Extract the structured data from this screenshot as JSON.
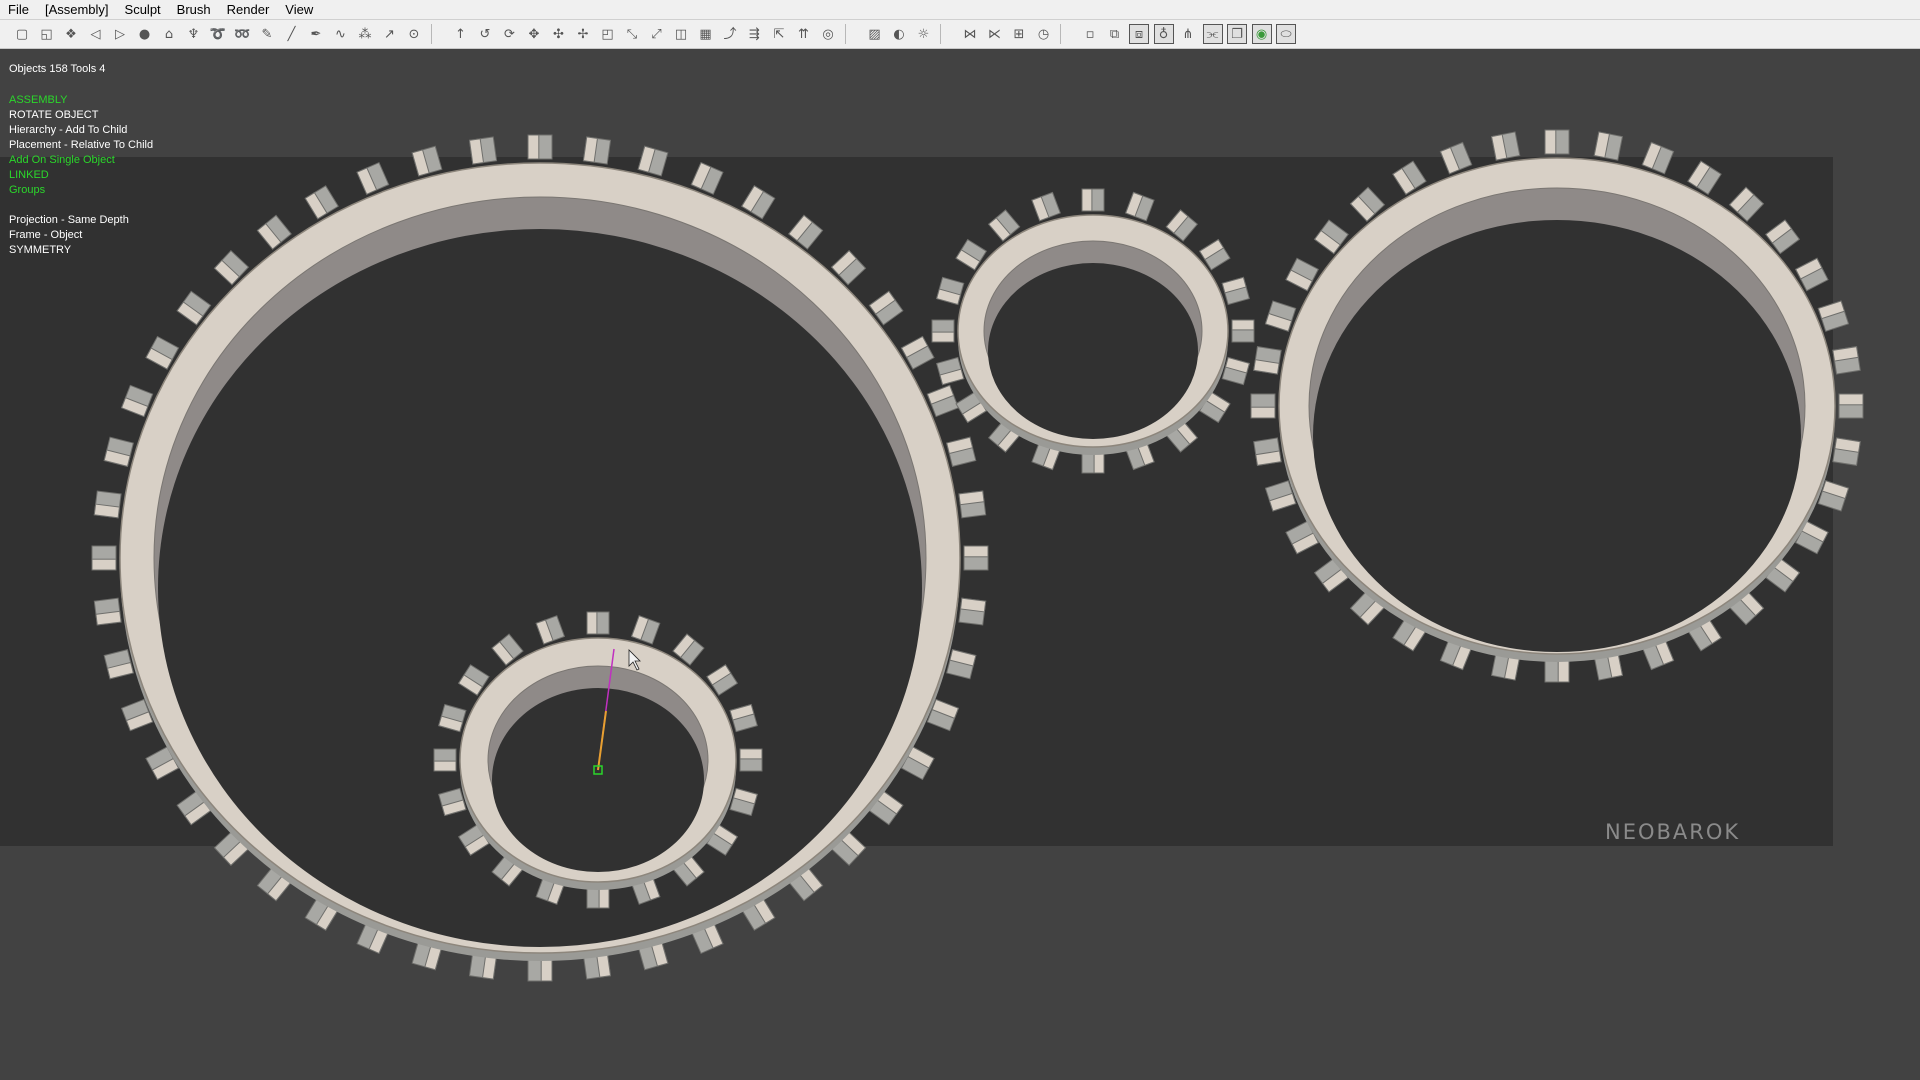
{
  "menu": {
    "items": [
      {
        "label": "File"
      },
      {
        "label": "[Assembly]"
      },
      {
        "label": "Sculpt"
      },
      {
        "label": "Brush"
      },
      {
        "label": "Render"
      },
      {
        "label": "View"
      }
    ]
  },
  "toolbar": {
    "groups": [
      [
        "new-icon",
        "open-icon",
        "snowflake-icon",
        "undo-icon",
        "redo-icon",
        "sphere-icon",
        "home-icon",
        "tree-icon",
        "lasso-icon",
        "lasso-plus-icon",
        "brush-icon",
        "line-icon",
        "pen-icon",
        "curve-icon",
        "spray-icon",
        "grab-icon",
        "target-icon"
      ],
      [
        "pin-icon",
        "rotate-icon",
        "rotate-cw-icon",
        "move-icon",
        "move-alt-icon",
        "move-free-icon",
        "scale-icon",
        "stretch-icon",
        "bend-icon",
        "mirror-icon",
        "grid-icon",
        "link-icon",
        "link-multi-icon",
        "drag-out-icon",
        "align-icon",
        "circles-icon"
      ],
      [
        "hatch-icon",
        "contrast-icon",
        "sun-icon"
      ],
      [
        "merge-icon",
        "split-icon",
        "fit-icon",
        "clock-icon"
      ],
      [
        "frame-icon",
        "window-icon",
        "window-active-icon",
        "ring-icon",
        "symmetry-icon",
        "link-bracket-icon",
        "copy-icon",
        "color-icon",
        "capsule-icon"
      ]
    ],
    "active_icons": [
      "window-active-icon",
      "ring-icon",
      "link-bracket-icon",
      "copy-icon",
      "color-icon",
      "capsule-icon"
    ]
  },
  "info": {
    "counts": "Objects 158   Tools 4",
    "lines": [
      {
        "text": "ASSEMBLY",
        "color": "green"
      },
      {
        "text": "ROTATE OBJECT",
        "color": "white"
      },
      {
        "text": "Hierarchy - Add To Child",
        "color": "white"
      },
      {
        "text": "Placement - Relative To Child",
        "color": "white"
      },
      {
        "text": "Add On Single Object",
        "color": "green"
      },
      {
        "text": "LINKED",
        "color": "green"
      },
      {
        "text": "Groups",
        "color": "green"
      },
      {
        "text": "",
        "color": "white"
      },
      {
        "text": "Projection - Same Depth",
        "color": "white"
      },
      {
        "text": "Frame - Object",
        "color": "white"
      },
      {
        "text": "SYMMETRY",
        "color": "white"
      }
    ]
  },
  "viewport": {
    "watermark": "NEOBAROK",
    "colors": {
      "background": "#424242",
      "render_area": "#313131",
      "gear_top": "#d8d0c6",
      "gear_side": "#a8a8a4",
      "accent_green": "#2bd62b",
      "manipulator": "#c030c0"
    },
    "gears": [
      {
        "name": "large-left",
        "teeth": 48
      },
      {
        "name": "small-center",
        "teeth": 20
      },
      {
        "name": "medium-right",
        "teeth": 20
      },
      {
        "name": "large-right",
        "teeth": 36
      }
    ]
  }
}
